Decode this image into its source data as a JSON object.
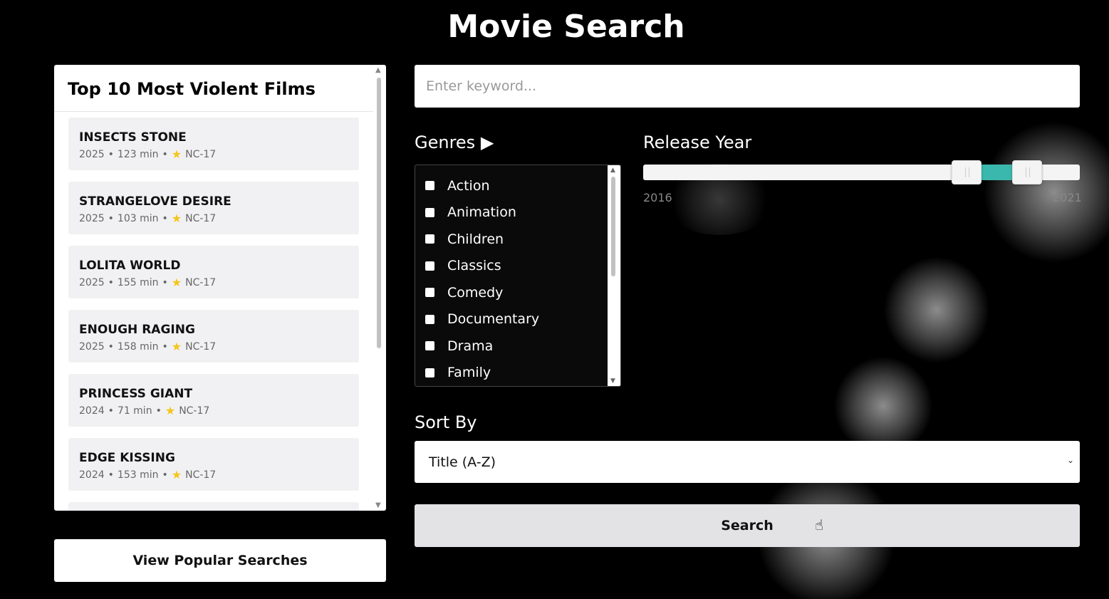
{
  "header": {
    "title": "Movie Search"
  },
  "top_films": {
    "title": "Top 10 Most Violent Films",
    "items": [
      {
        "title": "INSECTS STONE",
        "year": "2025",
        "duration": "123 min",
        "rating": "NC-17"
      },
      {
        "title": "STRANGELOVE DESIRE",
        "year": "2025",
        "duration": "103 min",
        "rating": "NC-17"
      },
      {
        "title": "LOLITA WORLD",
        "year": "2025",
        "duration": "155 min",
        "rating": "NC-17"
      },
      {
        "title": "ENOUGH RAGING",
        "year": "2025",
        "duration": "158 min",
        "rating": "NC-17"
      },
      {
        "title": "PRINCESS GIANT",
        "year": "2024",
        "duration": "71 min",
        "rating": "NC-17"
      },
      {
        "title": "EDGE KISSING",
        "year": "2024",
        "duration": "153 min",
        "rating": "NC-17"
      }
    ]
  },
  "popular_button": {
    "label": "View Popular Searches"
  },
  "search": {
    "placeholder": "Enter keyword..."
  },
  "genres": {
    "label": "Genres ▶",
    "items": [
      "Action",
      "Animation",
      "Children",
      "Classics",
      "Comedy",
      "Documentary",
      "Drama",
      "Family"
    ]
  },
  "release_year": {
    "label": "Release Year",
    "min_label": "2016",
    "max_label": "2021",
    "range_start_fraction": 0.74,
    "range_end_fraction": 0.88
  },
  "sort": {
    "label": "Sort By",
    "selected": "Title (A-Z)"
  },
  "search_button": {
    "label": "Search"
  },
  "colors": {
    "accent": "#3bb8ad",
    "star": "#f5c518"
  }
}
